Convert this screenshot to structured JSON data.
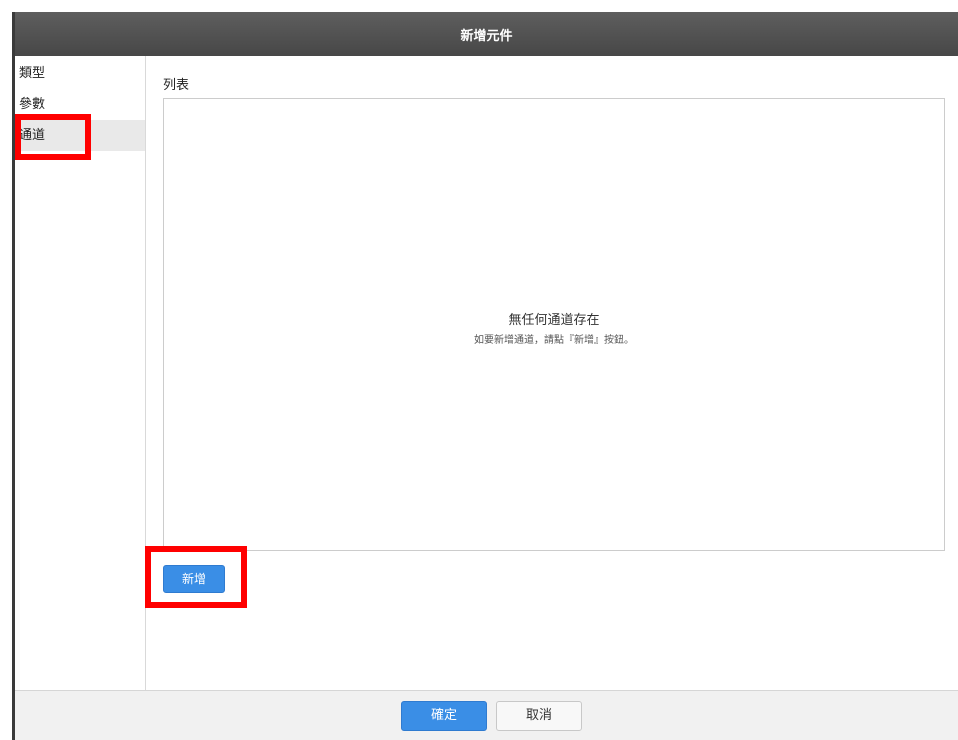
{
  "dialog": {
    "title": "新增元件",
    "sidebar": {
      "items": [
        {
          "label": "類型",
          "active": false
        },
        {
          "label": "參數",
          "active": false
        },
        {
          "label": "通道",
          "active": true
        }
      ]
    },
    "main": {
      "list_label": "列表",
      "empty_title": "無任何通道存在",
      "empty_hint": "如要新增通道，請點『新增』按鈕。",
      "add_button": "新增"
    },
    "footer": {
      "ok_label": "確定",
      "cancel_label": "取消"
    }
  },
  "colors": {
    "titlebar": "#4f4f4f",
    "primary_button": "#3a8ee6",
    "active_item_bg": "#e9e9e9",
    "highlight": "#ff0000"
  }
}
